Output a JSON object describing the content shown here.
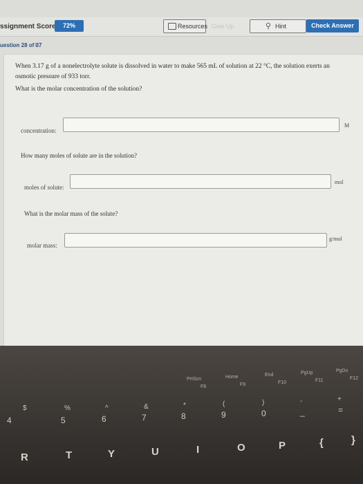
{
  "header": {
    "score_label": "ssignment Score:",
    "score_value": "72%",
    "resources_label": "Resources",
    "ghost_text": "Give Up",
    "hint_label": "Hint",
    "check_answer_label": "Check Answer"
  },
  "question_nav": {
    "label": "uestion 28 of 37"
  },
  "question": {
    "text": "When 3.17 g of a nonelectrolyte solute is dissolved in water to make 565 mL of solution at 22 °C, the solution exerts an osmotic pressure of 933 torr.",
    "ask": "What is the molar concentration of the solution?"
  },
  "fields": [
    {
      "label": "concentration:",
      "value": "",
      "unit": "M"
    },
    {
      "label": "moles of solute:",
      "value": "",
      "unit": "mol"
    },
    {
      "label": "molar mass:",
      "value": "",
      "unit": "g/mol"
    }
  ],
  "sub_questions": {
    "moles": "How many moles of solute are in the solution?",
    "molar_mass": "What is the molar mass of the solute?"
  },
  "keyboard": {
    "fn_keys": [
      "PrtScn",
      "Home",
      "End",
      "PgUp",
      "PgDn"
    ],
    "fn_sub": [
      "F8",
      "F9",
      "F10",
      "F11",
      "F12"
    ],
    "num_top": [
      "$",
      "%",
      "^",
      "&",
      "*",
      "(",
      ")",
      "-",
      "+"
    ],
    "num_main": [
      "4",
      "5",
      "6",
      "7",
      "8",
      "9",
      "0",
      "_",
      "="
    ],
    "letters": [
      "R",
      "T",
      "Y",
      "U",
      "I",
      "O",
      "P",
      "{",
      "}"
    ]
  },
  "colors": {
    "accent": "#2d6fb5",
    "nav_text": "#2c4f7a"
  }
}
